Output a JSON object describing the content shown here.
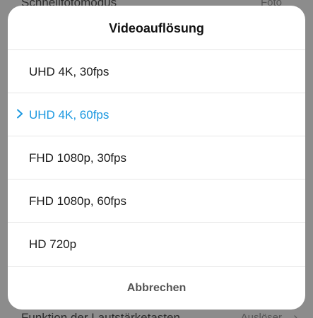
{
  "background": {
    "top_row": {
      "label": "Schnellfotomodus",
      "value": "Foto"
    },
    "bottom_row": {
      "label": "Funktion der Lautstärketasten",
      "value": "Auslöser"
    }
  },
  "dialog": {
    "title": "Videoauflösung",
    "options": [
      {
        "label": "UHD 4K, 30fps",
        "selected": false
      },
      {
        "label": "UHD 4K, 60fps",
        "selected": true
      },
      {
        "label": "FHD 1080p, 30fps",
        "selected": false
      },
      {
        "label": "FHD 1080p, 60fps",
        "selected": false
      },
      {
        "label": "HD 720p",
        "selected": false
      }
    ],
    "cancel_label": "Abbrechen"
  },
  "colors": {
    "accent": "#1b98e0",
    "overlay": "#8c8c8c",
    "dialog_bg": "#ffffff"
  },
  "icons": {
    "selected_marker": "chevron-right-icon",
    "row_chevron": "chevron-right-icon"
  }
}
